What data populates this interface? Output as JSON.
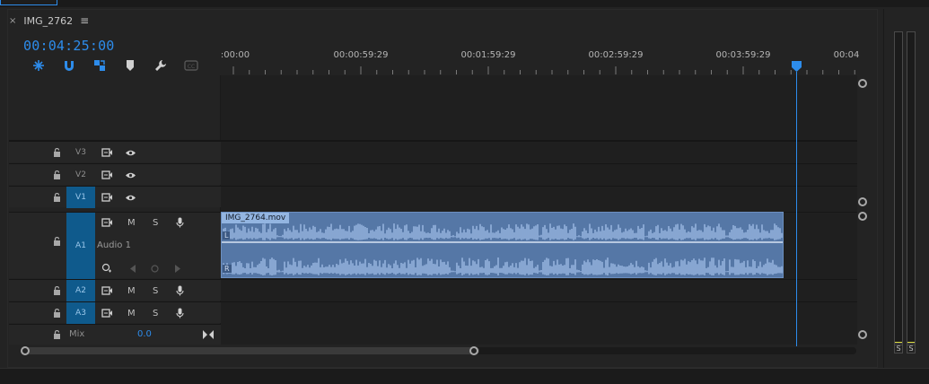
{
  "sequence": {
    "tab_name": "IMG_2762",
    "close_glyph": "×",
    "menu_glyph": "≡",
    "timecode": "00:04:25:00"
  },
  "toolbar": [
    "snap-nest-icon",
    "magnet-snap-icon",
    "linked-selection-icon",
    "add-marker-icon",
    "wrench-settings-icon",
    "captions-icon"
  ],
  "ruler": {
    "labels": [
      ":00:00",
      "00:00:59:29",
      "00:01:59:29",
      "00:02:59:29",
      "00:03:59:29",
      "00:04"
    ],
    "label_seconds": [
      0,
      60,
      120,
      180,
      240,
      300
    ]
  },
  "playhead": {
    "seconds": 265
  },
  "video_tracks": [
    {
      "name": "V3",
      "selected": false
    },
    {
      "name": "V2",
      "selected": false
    },
    {
      "name": "V1",
      "selected": true
    }
  ],
  "audio_tracks": [
    {
      "name": "A1",
      "label": "Audio 1",
      "selected": true,
      "mute": "M",
      "solo": "S"
    },
    {
      "name": "A2",
      "selected": true,
      "mute": "M",
      "solo": "S"
    },
    {
      "name": "A3",
      "selected": true,
      "mute": "M",
      "solo": "S"
    }
  ],
  "mix": {
    "label": "Mix",
    "value": "0.0"
  },
  "clip": {
    "name": "IMG_2764.mov",
    "channel_top": "L",
    "channel_bottom": "R",
    "color": "#5577a6"
  },
  "meter": {
    "solo_left": "S",
    "solo_right": "S"
  },
  "colors": {
    "accent": "#2d8ceb",
    "track_selected": "#0f5a8c",
    "clip_label": "#93b5e1"
  }
}
